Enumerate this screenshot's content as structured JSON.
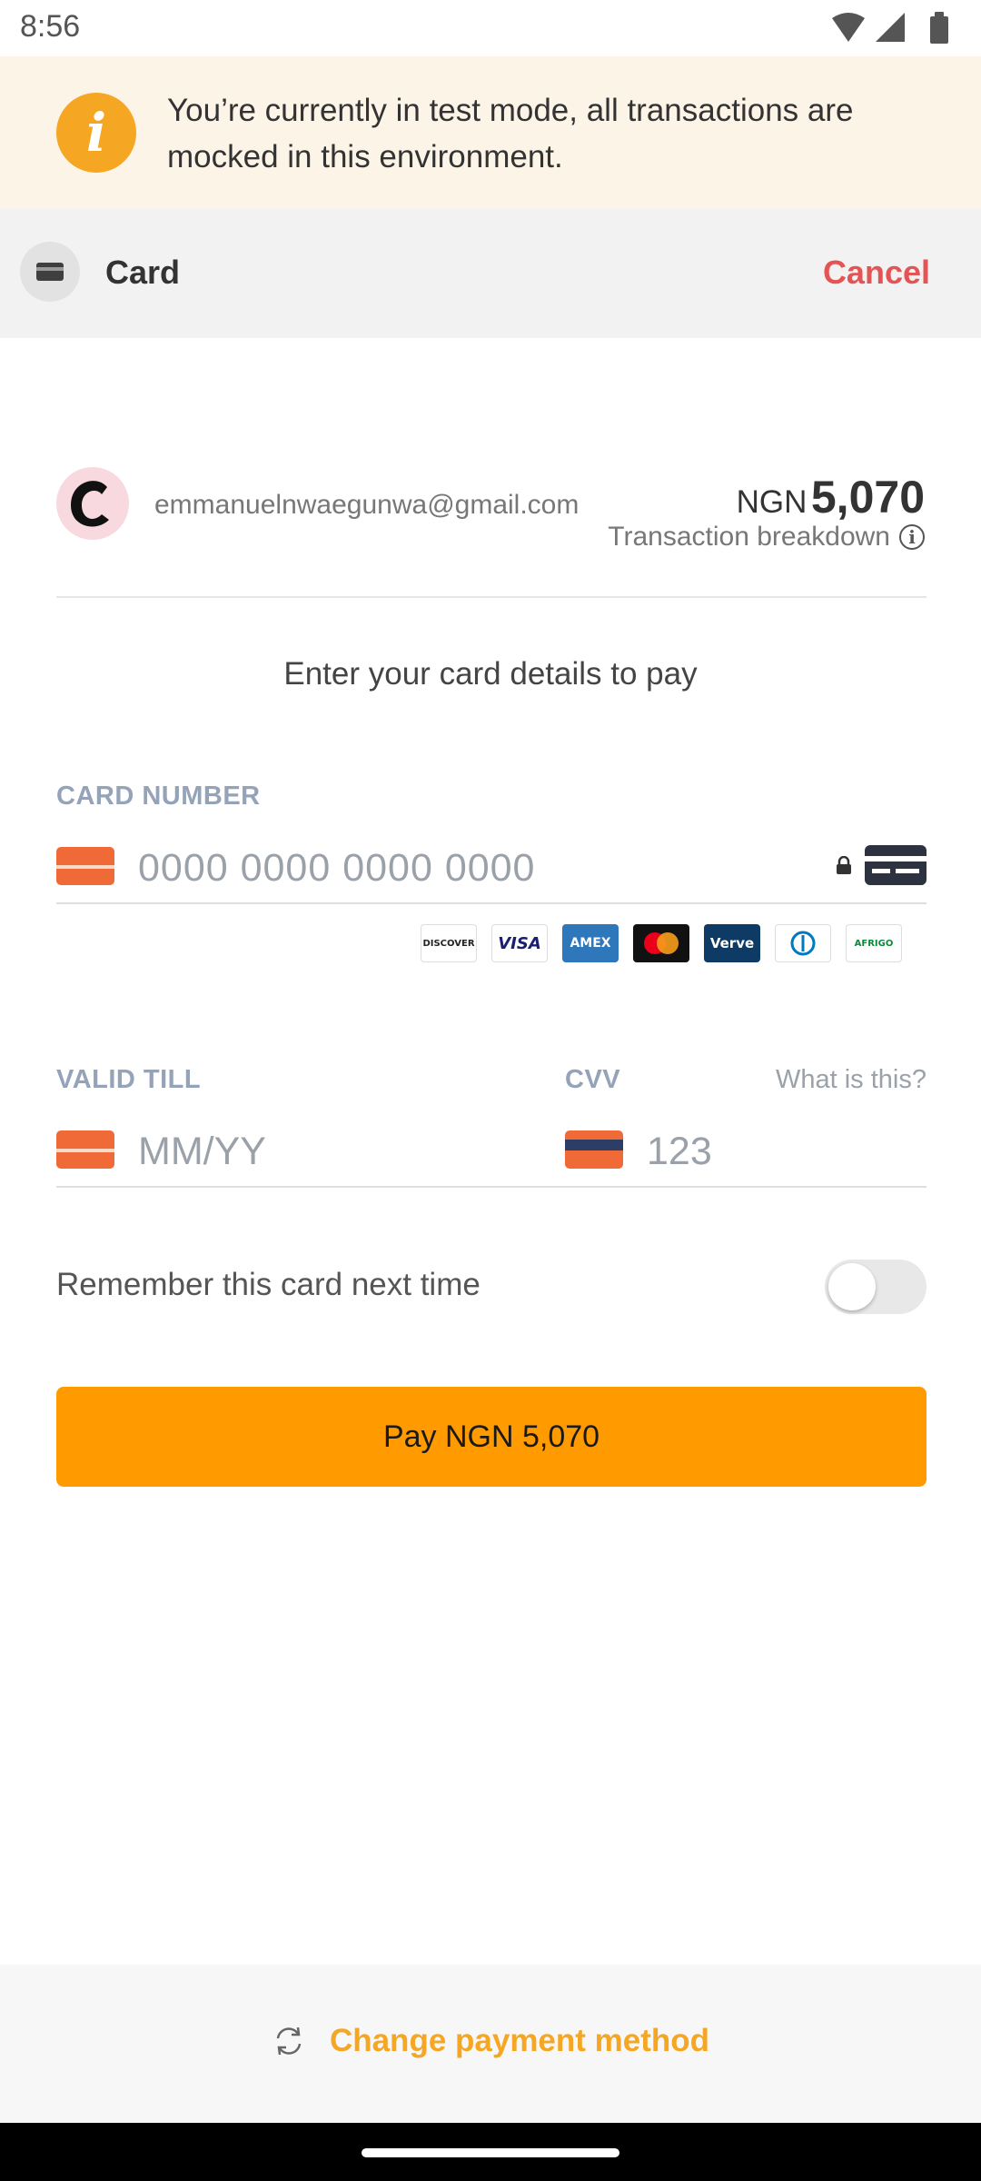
{
  "status_bar": {
    "time": "8:56"
  },
  "banner": {
    "text": "You’re currently in test mode, all transactions are mocked in this environment.",
    "icon": "info-icon"
  },
  "header": {
    "title": "Card",
    "cancel_label": "Cancel"
  },
  "merchant": {
    "email": "emmanuelnwaegunwa@gmail.com",
    "currency": "NGN",
    "amount": "5,070",
    "breakdown_label": "Transaction breakdown"
  },
  "instruction": "Enter your card details to pay",
  "card_number": {
    "label": "CARD NUMBER",
    "placeholder": "0000 0000 0000 0000"
  },
  "brands": [
    "DISCOVER",
    "VISA",
    "AMEX",
    "mastercard",
    "Verve",
    "Diners",
    "AFRIGO"
  ],
  "valid_till": {
    "label": "VALID TILL",
    "placeholder": "MM/YY"
  },
  "cvv": {
    "label": "CVV",
    "placeholder": "123",
    "help_label": "What is this?"
  },
  "remember": {
    "label": "Remember this card next time",
    "enabled": false
  },
  "pay_button": {
    "label": "Pay NGN 5,070"
  },
  "footer": {
    "change_label": "Change payment method"
  },
  "colors": {
    "accent": "#ff9b00",
    "cancel": "#e35454",
    "banner_bg": "#fdf4e8",
    "card_icon": "#f06a38"
  }
}
